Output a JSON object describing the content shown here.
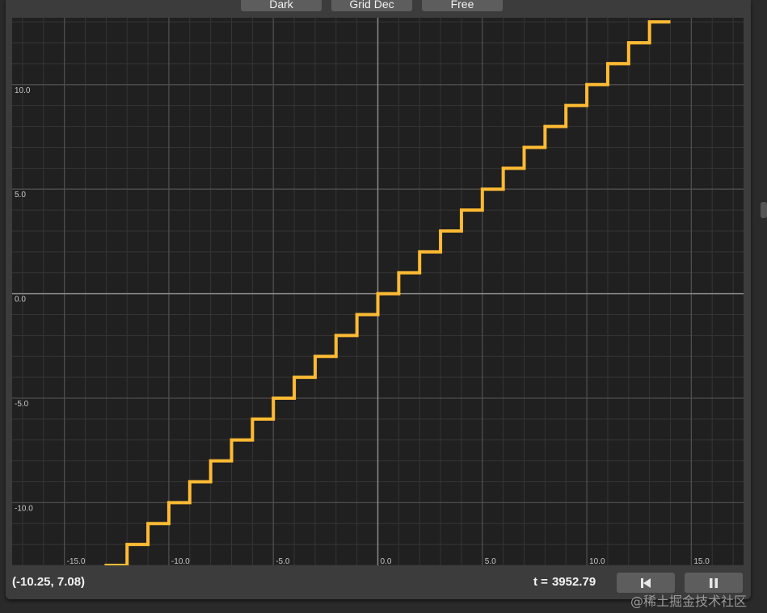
{
  "toolbar": {
    "buttons": [
      "Dark",
      "Grid Dec",
      "Free"
    ]
  },
  "status": {
    "coordinates": "(-10.25, 7.08)",
    "time_label": "t =",
    "time_value": "3952.79"
  },
  "controls": {
    "reset_icon": "skip-back-icon",
    "pause_icon": "pause-icon"
  },
  "watermark": "@稀土掘金技术社区",
  "colors": {
    "curve": "#ffbb33",
    "background": "#202020",
    "axis": "#8a8a8a"
  },
  "chart_data": {
    "type": "line",
    "title": "",
    "xlabel": "",
    "ylabel": "",
    "xlim": [
      -17.5,
      17.5
    ],
    "ylim": [
      -13,
      13.2
    ],
    "x_ticks": [
      "-15.0",
      "-10.0",
      "-5.0",
      "0.0",
      "5.0",
      "10.0",
      "15.0"
    ],
    "y_ticks": [
      "10.0",
      "5.0",
      "0.0",
      "-5.0",
      "-10.0"
    ],
    "grid": true,
    "series": [
      {
        "function": "floor(x)",
        "x_range": [
          -14,
          13
        ]
      }
    ]
  }
}
